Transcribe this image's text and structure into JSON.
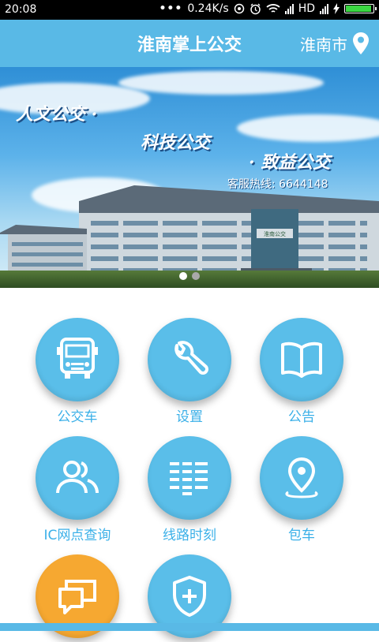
{
  "status_bar": {
    "time": "20:08",
    "network_speed": "0.24K/s",
    "network_type": "HD",
    "icons": [
      "dots-icon",
      "hotspot-icon",
      "alarm-icon",
      "wifi-icon",
      "signal-icon",
      "signal-icon",
      "charging-icon",
      "battery-icon"
    ],
    "battery_level": 0.9
  },
  "app_bar": {
    "title": "淮南掌上公交",
    "city": "淮南市",
    "city_icon": "location-pin-icon",
    "color": "#59b9e6"
  },
  "banner": {
    "slogan_1": "人文公交",
    "slogan_2": "科技公交",
    "slogan_3": "致益公交",
    "hotline": "客服热线: 6644148",
    "building_sign": "淮南公交",
    "page_count": 2,
    "active_page": 1
  },
  "menu": {
    "accent_color": "#5abee9",
    "label_color": "#3bb0e8",
    "items": [
      {
        "label": "公交车",
        "icon": "bus-icon"
      },
      {
        "label": "设置",
        "icon": "wrench-icon"
      },
      {
        "label": "公告",
        "icon": "book-icon"
      },
      {
        "label": "IC网点查询",
        "icon": "users-icon"
      },
      {
        "label": "线路时刻",
        "icon": "schedule-grid-icon"
      },
      {
        "label": "包车",
        "icon": "map-pin-icon"
      },
      {
        "label": "",
        "icon": "chat-icon",
        "color": "#f6a831"
      },
      {
        "label": "",
        "icon": "shield-plus-icon"
      }
    ]
  }
}
